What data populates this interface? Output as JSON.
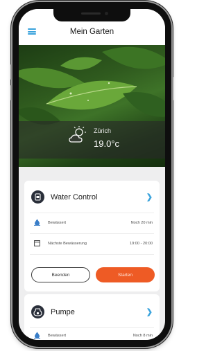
{
  "header": {
    "title": "Mein Garten",
    "menu_icon": "hamburger-menu-icon"
  },
  "weather": {
    "city": "Zürich",
    "temperature": "19.0°c",
    "icon": "partly-sunny-icon"
  },
  "carousel": {
    "pages": 2,
    "active": 2
  },
  "devices": [
    {
      "name": "Water Control",
      "icon": "water-control-icon",
      "rows": [
        {
          "icon": "water-drop-icon",
          "label": "Bewässert",
          "value": "Noch 20 min"
        },
        {
          "icon": "calendar-icon",
          "label": "Nächste Bewässerung",
          "value": "19:00 - 20:00"
        }
      ],
      "buttons": {
        "stop": "Beenden",
        "start": "Starten"
      }
    },
    {
      "name": "Pumpe",
      "icon": "pump-icon",
      "rows": [
        {
          "icon": "water-drop-icon",
          "label": "Bewässert",
          "value": "Noch 8 min"
        }
      ]
    }
  ],
  "colors": {
    "accent": "#3aa3dc",
    "start_button": "#ee5b25",
    "device_icon": "#2a2f3a"
  }
}
